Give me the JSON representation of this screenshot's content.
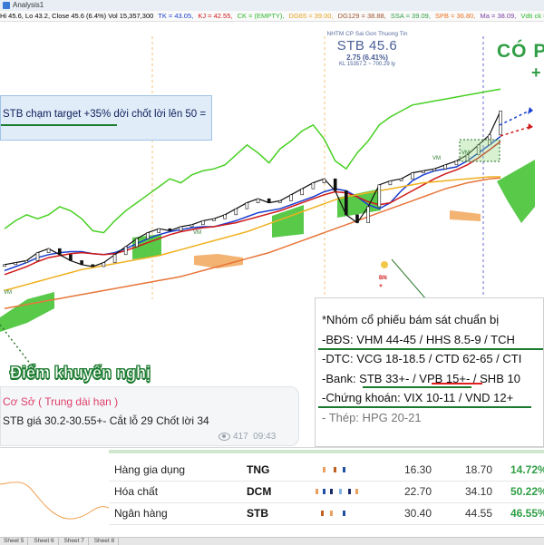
{
  "window": {
    "title": "Analysis1"
  },
  "ohlc_bar": {
    "ohlc": "Hi 45.6, Lo 43.2, Close 45.6 (6.4%) Vol 15,357,300",
    "tk": "TK = 43.05,",
    "kj": "KJ = 42.55,",
    "ck": "CK = (EMPTY),",
    "dg65": "DG65 = 39.00,",
    "dg129": "DG129 = 38.88,",
    "ssa": "SSA = 39.09,",
    "spb": "SPB = 36.80,",
    "ma": "Ma = 38.09,",
    "vol_ck": "Vdti ck = (EMPTY)",
    "colors": {
      "tk": "#1a3fd0",
      "kj": "#d01a1a",
      "ck": "#2fb82f",
      "dg65": "#e8a020",
      "dg129": "#a0522d",
      "ssa": "#2f9e44",
      "spb": "#e87020",
      "ma": "#7b3fa0",
      "vol_ck": "#2fb82f"
    }
  },
  "stock": {
    "company": "NHTM CP Sai Gon Thuong Tin",
    "ticker_price": "STB 45.6",
    "change": "2.75 (6.41%)",
    "volume": "KL 15357.2 ~ 700.29 ty"
  },
  "annotation": {
    "co_text": "CÓ P",
    "plus_text": "+"
  },
  "note": {
    "text": "STB chạm target +35% dời chốt lời lên 50 ="
  },
  "group": {
    "lines": [
      "*Nhóm cổ phiếu bám sát chuẩn bị",
      "-BĐS: VHM 44-45 / HHS 8.5-9 / TCH",
      "-DTC: VCG 18-18.5 / CTD 62-65 / CTI",
      "-Bank: STB 33+- / VPB 15+- / SHB 10",
      "-Chứng khoán: VIX 10-11 / VND 12+",
      "- Thép: HPG 20-21"
    ]
  },
  "recommend": {
    "label": "Điểm khuyến nghị"
  },
  "message": {
    "title": "Cơ Sở ( Trung dài hạn )",
    "body": "STB giá 30.2-30.55+- Cắt lỗ 29 Chốt lời 34",
    "views": "417",
    "time": "09:43"
  },
  "chart_markers": {
    "vm1": "VM",
    "vm2": "VM",
    "vm3": "VM",
    "vm4": "VM",
    "bn": "BN",
    "star": "*"
  },
  "table": {
    "rows": [
      {
        "name": "Hàng gia dụng",
        "ticker": "TNG",
        "a": "16.30",
        "b": "18.70",
        "pct": "14.72%"
      },
      {
        "name": "Hóa chất",
        "ticker": "DCM",
        "a": "22.70",
        "b": "34.10",
        "pct": "50.22%"
      },
      {
        "name": "Ngân hàng",
        "ticker": "STB",
        "a": "30.40",
        "b": "44.55",
        "pct": "46.55%"
      }
    ]
  },
  "sheet_tabs": [
    "Sheet 5",
    "Sheet 6",
    "Sheet 7",
    "Sheet 8"
  ],
  "chart_data": {
    "type": "line",
    "title": "STB 45.6",
    "xlabel": "",
    "ylabel": "",
    "ylim": [
      24,
      48
    ],
    "series": [
      {
        "name": "TK",
        "color": "#1a3fd0",
        "values": [
          29.6,
          30,
          30.4,
          30.9,
          31.2,
          31.4,
          31.5,
          31.5,
          31.3,
          31.2,
          31.4,
          31.8,
          32.3,
          32.8,
          33.2,
          33.5,
          33.7,
          33.9,
          34,
          34,
          34.3,
          34.6,
          35,
          35.4,
          35.6,
          35.8,
          36.2,
          36.6,
          37,
          37.5,
          37.8,
          37.6,
          37,
          36.2,
          35.8,
          36.4,
          37.6,
          38.6,
          39.2,
          39.6,
          39.8,
          40,
          40.6,
          41.4,
          42.2,
          43.05
        ]
      },
      {
        "name": "KJ",
        "color": "#d01a1a",
        "values": [
          29.2,
          29.6,
          30,
          30.5,
          30.9,
          31.1,
          31.3,
          31.4,
          31.3,
          31.2,
          31.3,
          31.6,
          32,
          32.4,
          32.8,
          33.2,
          33.5,
          33.7,
          33.9,
          34,
          34.2,
          34.4,
          34.7,
          35,
          35.3,
          35.6,
          36,
          36.4,
          36.8,
          37.2,
          37.5,
          37.4,
          37,
          36.5,
          36.2,
          36.4,
          37,
          37.6,
          38.2,
          38.8,
          39.3,
          39.7,
          40.2,
          40.9,
          41.7,
          42.55
        ]
      },
      {
        "name": "CK",
        "color": "#48d022",
        "values": [
          33.8,
          34.6,
          35.2,
          34.8,
          35.2,
          36,
          35.6,
          34.8,
          33.6,
          33.4,
          34.6,
          35.6,
          36.4,
          37.2,
          38,
          38.8,
          38.4,
          39.2,
          39.6,
          39.8,
          40.2,
          41.2,
          42.2,
          41.4,
          40.4,
          41.8,
          42.6,
          43.6,
          44.2,
          42.8,
          40.6,
          39.8,
          41.4,
          42.6,
          44.2,
          45,
          45.6,
          46.2,
          46.4,
          46.6,
          46.8,
          47,
          47.2,
          47.4,
          47.6,
          47.8
        ]
      },
      {
        "name": "DG65",
        "color": "#f0b020",
        "values": [
          27.6,
          27.9,
          28.2,
          28.5,
          28.8,
          29.1,
          29.4,
          29.7,
          29.9,
          30.1,
          30.3,
          30.5,
          30.7,
          30.9,
          31.1,
          31.4,
          31.7,
          32,
          32.3,
          32.6,
          32.9,
          33.2,
          33.5,
          33.9,
          34.3,
          34.7,
          35.1,
          35.5,
          35.9,
          36.3,
          36.7,
          37,
          37.2,
          37.4,
          37.6,
          37.8,
          38,
          38.2,
          38.4,
          38.5,
          38.6,
          38.7,
          38.8,
          38.9,
          39,
          39
        ]
      },
      {
        "name": "DG129",
        "color": "#e8763a",
        "values": [
          25.8,
          26,
          26.2,
          26.4,
          26.6,
          26.8,
          27,
          27.2,
          27.4,
          27.6,
          27.8,
          28,
          28.2,
          28.4,
          28.6,
          28.8,
          29,
          29.3,
          29.6,
          29.9,
          30.2,
          30.5,
          30.8,
          31.1,
          31.4,
          31.8,
          32.2,
          32.6,
          33,
          33.4,
          33.8,
          34.2,
          34.6,
          35,
          35.4,
          35.8,
          36.2,
          36.6,
          37,
          37.4,
          37.8,
          38.1,
          38.4,
          38.6,
          38.8,
          38.88
        ]
      },
      {
        "name": "Price",
        "color": "#111111",
        "values": [
          30.2,
          30.4,
          30.6,
          31.4,
          31.8,
          31.2,
          30.6,
          30.2,
          30,
          30.4,
          31.2,
          32,
          32.8,
          33.4,
          33.8,
          33.6,
          34,
          34.2,
          34.6,
          34.8,
          35.2,
          35.8,
          36.4,
          36.8,
          36.4,
          36.6,
          37.2,
          37.8,
          38.4,
          38.8,
          37.6,
          35.2,
          34.4,
          36,
          38.2,
          38.6,
          38.8,
          39.4,
          39.6,
          39.8,
          40.2,
          40.6,
          41.2,
          42.2,
          43.2,
          45.6
        ]
      }
    ]
  }
}
